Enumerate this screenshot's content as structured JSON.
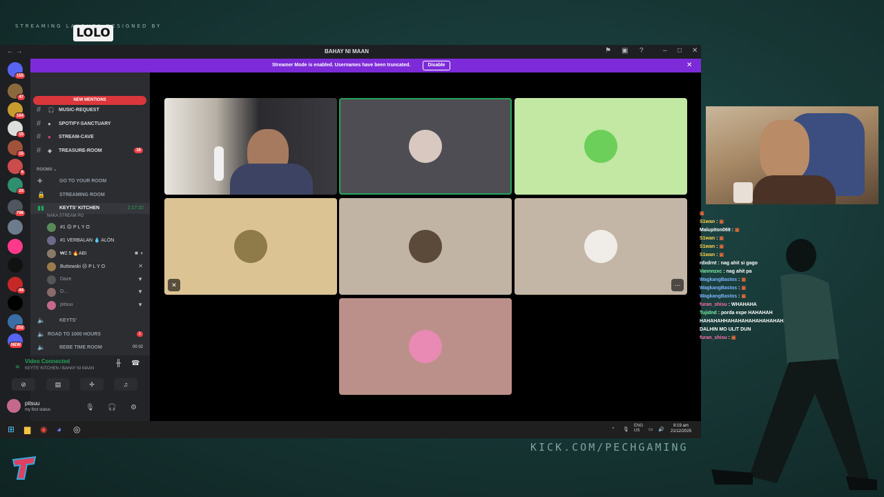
{
  "overlay": {
    "brand_text": "STREAMING LAYOUTS DESIGNED BY",
    "brand_logo": "LOLO",
    "kick_url": "KICK.COM/PECHGAMING"
  },
  "window": {
    "title": "BAHAY NI MAAN",
    "nav": "←  →"
  },
  "banner": {
    "message": "Streamer Mode is enabled. Usernames have been truncated.",
    "button": "Disable"
  },
  "servers": [
    {
      "badge": "155",
      "color": "#5865f2"
    },
    {
      "badge": "47",
      "color": "#8a6a3c"
    },
    {
      "badge": "164",
      "color": "#c89b2e"
    },
    {
      "badge": "15",
      "color": "#dddddd"
    },
    {
      "badge": "15",
      "color": "#a0523a"
    },
    {
      "badge": "6",
      "color": "#cc4c4c"
    },
    {
      "badge": "24",
      "color": "#2f8f6f"
    },
    {
      "badge": "796",
      "color": "#4f5660"
    },
    {
      "badge": "",
      "color": "#6d7c8c"
    },
    {
      "badge": "",
      "color": "#ff3a8c"
    },
    {
      "badge": "",
      "color": "#111111"
    },
    {
      "badge": "44",
      "color": "#c62828"
    },
    {
      "badge": "",
      "color": "#000000"
    },
    {
      "badge": "252",
      "color": "#3a6ea5"
    },
    {
      "badge": "NEW",
      "color": "#5865f2"
    }
  ],
  "sidebar": {
    "server_name": "BAHAY NI MAAN",
    "new_mentions": "NEW MENTIONS",
    "text_channels": [
      {
        "name": "music-request",
        "count": ""
      },
      {
        "name": "spotify-sanctuary",
        "count": ""
      },
      {
        "name": "stream-cave",
        "count": ""
      },
      {
        "name": "treasure-room",
        "count": "18"
      }
    ],
    "rooms_label": "ROOMS",
    "voice_channels": [
      {
        "name": "go to your room"
      },
      {
        "name": "streaming room"
      }
    ],
    "active_channel": {
      "name": "KEYTS' KITCHEN",
      "timer": "2:17:32",
      "sub": "NAKA STREAM PO"
    },
    "members": [
      {
        "name": "#1 ☹ P L Y O",
        "status": "",
        "color": "#5a8a5a"
      },
      {
        "name": "#1 VERBALAN 💧 ALÖN",
        "status": "",
        "color": "#6a6a8a"
      },
      {
        "name": "₩2.5 🔥ABI",
        "status": "■ ◑",
        "color": "#8a7a6a"
      },
      {
        "name": "Buttowski ☹ P L Y O",
        "status": "✕",
        "color": "#9a7a4a"
      },
      {
        "name": "Daze",
        "status": "▼",
        "color": "#555555"
      },
      {
        "name": "D...",
        "status": "▼",
        "color": "#8a6a6a"
      },
      {
        "name": "pitsuu",
        "status": "▼",
        "color": "#c36a8a"
      }
    ],
    "more_voice": [
      {
        "name": "KEYTS'",
        "count": ""
      },
      {
        "name": "ROAD TO 1000 HOURS",
        "count": "1"
      },
      {
        "name": "BEBE TIME ROOM",
        "count": "00  02"
      }
    ]
  },
  "voice_panel": {
    "status": "Video Connected",
    "location": "KEYTS' KITCHEN / BAHAY NI MAAN"
  },
  "user": {
    "name": "pitsuu",
    "status": "my first status"
  },
  "tiles": [
    {
      "bg": "#3a3330",
      "kind": "video"
    },
    {
      "bg": "#4e4d53",
      "kind": "avatar",
      "ava": "#d8c8c0"
    },
    {
      "bg": "#c2e8a4",
      "kind": "avatar",
      "ava": "#6ccf5a"
    },
    {
      "bg": "#dcc393",
      "kind": "avatar",
      "ava": "#8f7a4a"
    },
    {
      "bg": "#c1b4a4",
      "kind": "avatar",
      "ava": "#5b4a3a"
    },
    {
      "bg": "#c4b6a6",
      "kind": "avatar",
      "ava": "#f0ece8"
    },
    {
      "bg": "#bc908a",
      "kind": "avatar",
      "ava": "#e88ab4"
    }
  ],
  "taskbar": {
    "lang": "ENG\nUS",
    "time": "8:19 am",
    "date": "21/12/2025"
  },
  "chat": [
    {
      "user": "",
      "msg": "",
      "color": "#ff5fa0"
    },
    {
      "user": "S1wan",
      "msg": "",
      "color": "#ffd24a"
    },
    {
      "user": "Malupiton069",
      "msg": "",
      "color": "#ffffff"
    },
    {
      "user": "S1wan",
      "msg": "",
      "color": "#ffd24a"
    },
    {
      "user": "S1wan",
      "msg": "",
      "color": "#ffd24a"
    },
    {
      "user": "S1wan",
      "msg": "",
      "color": "#ffd24a"
    },
    {
      "user": "rdxdrnt",
      "msg": "nag ahit si gago",
      "color": "#ffffff"
    },
    {
      "user": "Vannnzxc",
      "msg": "nag ahit pa",
      "color": "#7cf0a8"
    },
    {
      "user": "WagkangBastos",
      "msg": "",
      "color": "#7db6ff"
    },
    {
      "user": "WagkangBastos",
      "msg": "",
      "color": "#7db6ff"
    },
    {
      "user": "WagkangBastos",
      "msg": "",
      "color": "#7db6ff"
    },
    {
      "user": "furan_shisu",
      "msg": "WHAHAHA",
      "color": "#ff6fa8"
    },
    {
      "user": "Tujidnd",
      "msg": "porda expe HAHAHAH",
      "color": "#7cf0a8"
    },
    {
      "user": "",
      "msg": "HAHAHAHHAHAHAHAHAHAHAHAHAHAHAHHAAHAH",
      "color": "#ff5a5a"
    },
    {
      "user": "",
      "msg": "DALHIN MO ULIT DUN",
      "color": "#ffffff"
    },
    {
      "user": "furan_shisu",
      "msg": "",
      "color": "#ff6fa8"
    }
  ]
}
